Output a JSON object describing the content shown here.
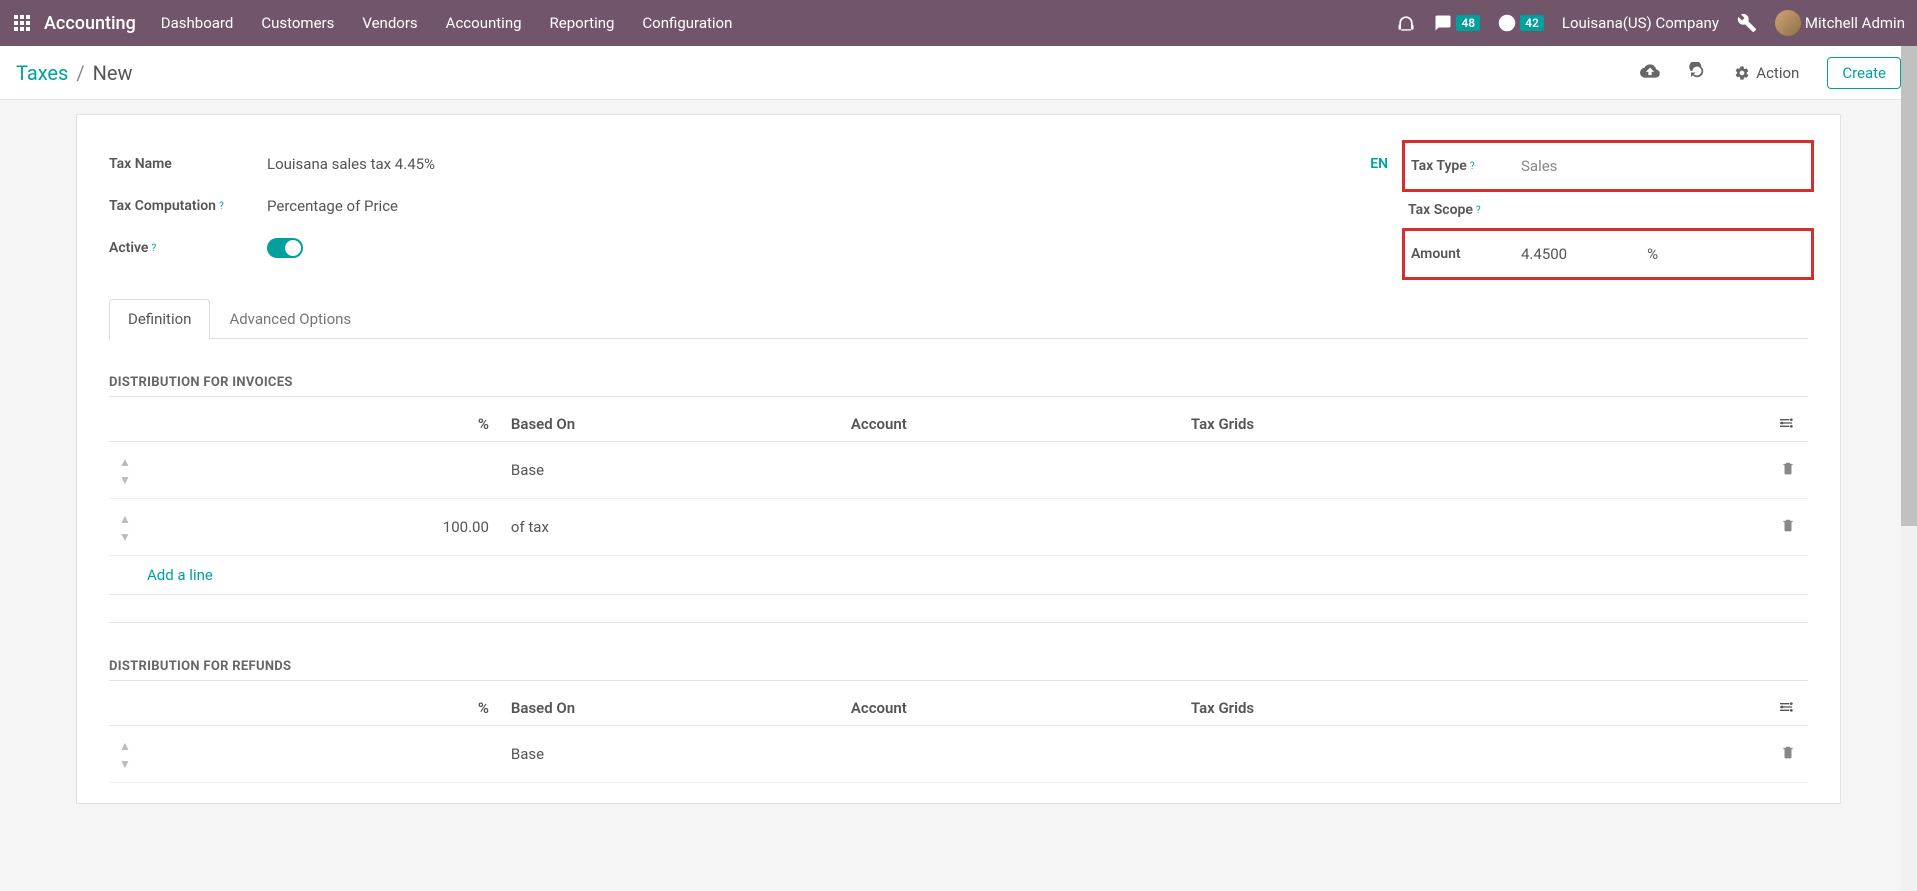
{
  "topbar": {
    "brand": "Accounting",
    "menu": [
      "Dashboard",
      "Customers",
      "Vendors",
      "Accounting",
      "Reporting",
      "Configuration"
    ],
    "messages_badge": "48",
    "activities_badge": "42",
    "company": "Louisana(US) Company",
    "user": "Mitchell Admin"
  },
  "controlbar": {
    "breadcrumb_root": "Taxes",
    "breadcrumb_current": "New",
    "action_label": "Action",
    "create_label": "Create"
  },
  "form": {
    "labels": {
      "tax_name": "Tax Name",
      "tax_computation": "Tax Computation",
      "active": "Active",
      "tax_type": "Tax Type",
      "tax_scope": "Tax Scope",
      "amount": "Amount"
    },
    "values": {
      "tax_name": "Louisana sales tax 4.45%",
      "tax_computation": "Percentage of Price",
      "tax_type": "Sales",
      "tax_scope": "",
      "amount": "4.4500",
      "amount_suffix": "%",
      "lang": "EN"
    },
    "tabs": {
      "definition": "Definition",
      "advanced": "Advanced Options"
    }
  },
  "distribution": {
    "invoices_title": "DISTRIBUTION FOR INVOICES",
    "refunds_title": "DISTRIBUTION FOR REFUNDS",
    "columns": {
      "pct": "%",
      "based_on": "Based On",
      "account": "Account",
      "tax_grids": "Tax Grids"
    },
    "invoice_rows": [
      {
        "pct": "",
        "based_on": "Base"
      },
      {
        "pct": "100.00",
        "based_on": "of tax"
      }
    ],
    "refund_rows": [
      {
        "pct": "",
        "based_on": "Base"
      }
    ],
    "add_line": "Add a line"
  }
}
